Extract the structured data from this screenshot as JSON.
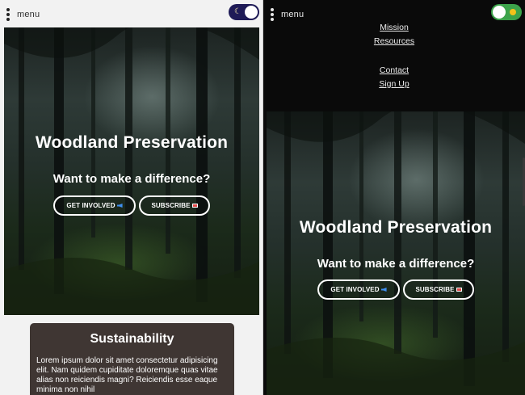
{
  "left": {
    "menu_label": "menu",
    "toggle_state": "dark",
    "hero": {
      "title": "Woodland Preservation",
      "subtitle": "Want to make a difference?",
      "get_involved_label": "GET INVOLVED",
      "subscribe_label": "SUBSCRIBE"
    },
    "card": {
      "title": "Sustainability",
      "text": "Lorem ipsum dolor sit amet consectetur adipisicing elit. Nam quidem cupiditate doloremque quas vitae alias non reiciendis magni? Reiciendis esse eaque minima non nihil"
    }
  },
  "right": {
    "menu_label": "menu",
    "toggle_state": "light",
    "nav": [
      "Mission",
      "Resources",
      "Contact",
      "Sign Up"
    ],
    "hero": {
      "title": "Woodland Preservation",
      "subtitle": "Want to make a difference?",
      "get_involved_label": "GET INVOLVED",
      "subscribe_label": "SUBSCRIBE"
    }
  },
  "icons": {
    "menu": "kebab-menu-icon",
    "dark_toggle": "moon-icon",
    "light_toggle": "sun-icon",
    "get_involved": "megaphone-icon",
    "subscribe": "mail-icon"
  },
  "colors": {
    "dark_toggle": "#1f1b57",
    "light_toggle": "#3ca34a",
    "card_bg": "#3f3633",
    "nav_bg": "#0a0a0a"
  }
}
